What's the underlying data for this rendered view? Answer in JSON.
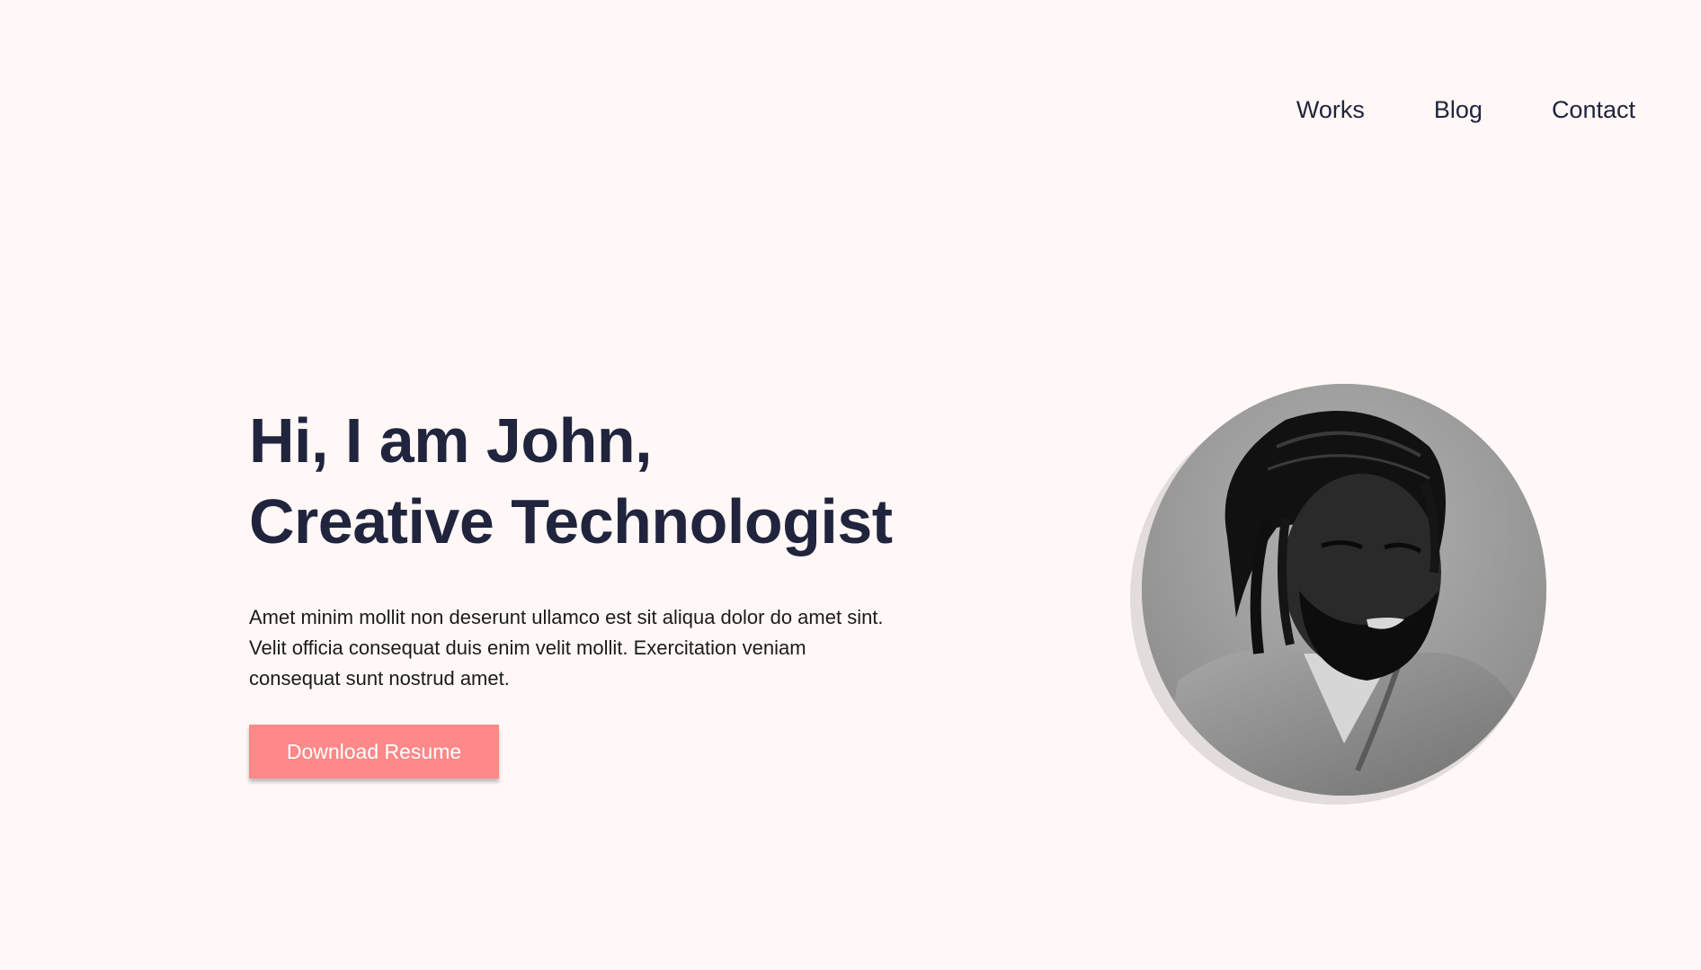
{
  "nav": {
    "items": [
      {
        "label": "Works"
      },
      {
        "label": "Blog"
      },
      {
        "label": "Contact"
      }
    ]
  },
  "hero": {
    "title_line1": "Hi, I am John,",
    "title_line2": "Creative Technologist",
    "description": "Amet minim mollit non deserunt ullamco est sit aliqua dolor do amet sint. Velit officia consequat duis enim velit mollit. Exercitation veniam consequat sunt nostrud amet.",
    "cta_label": "Download Resume"
  },
  "colors": {
    "background": "#FFF8F7",
    "text_dark": "#21243D",
    "accent": "#FF8888"
  },
  "avatar": {
    "icon": "portrait-photo"
  }
}
